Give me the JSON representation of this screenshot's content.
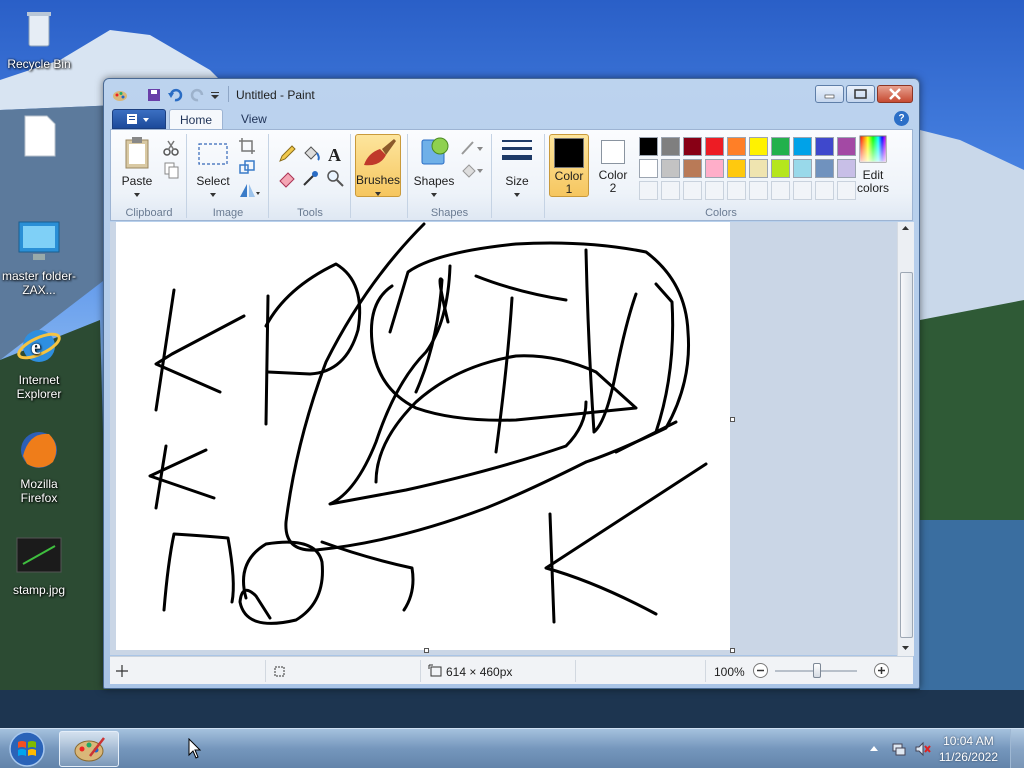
{
  "desktop": {
    "icons": [
      {
        "label": "Recycle Bin",
        "icon": "recycle-bin-icon"
      },
      {
        "label": "",
        "icon": "blank-file-icon"
      },
      {
        "label": "master folder-ZAX...",
        "icon": "network-computer-icon"
      },
      {
        "label": "Internet Explorer",
        "icon": "internet-explorer-icon"
      },
      {
        "label": "Mozilla Firefox",
        "icon": "firefox-icon"
      },
      {
        "label": "stamp.jpg",
        "icon": "image-file-icon"
      }
    ]
  },
  "window": {
    "title": "Untitled - Paint",
    "tabs": [
      "Home",
      "View"
    ],
    "help": "?",
    "groups": {
      "clipboard": {
        "label": "Clipboard",
        "paste": "Paste"
      },
      "image": {
        "label": "Image",
        "select": "Select"
      },
      "tools": {
        "label": "Tools"
      },
      "brushes": {
        "label": "Brushes"
      },
      "shapes": {
        "label": "Shapes",
        "shapes_btn": "Shapes"
      },
      "size": {
        "label": "Size"
      },
      "colors": {
        "label": "Colors",
        "color1": "Color",
        "color1_num": "1",
        "color2": "Color",
        "color2_num": "2",
        "edit_colors_1": "Edit",
        "edit_colors_2": "colors",
        "row1": [
          "#000000",
          "#7f7f7f",
          "#880015",
          "#ed1c24",
          "#ff7f27",
          "#fff200",
          "#22b14c",
          "#00a2e8",
          "#3f48cc",
          "#a349a4"
        ],
        "row2": [
          "#ffffff",
          "#c3c3c3",
          "#b97a57",
          "#ffaec9",
          "#ffc90e",
          "#efe4b0",
          "#b5e61d",
          "#99d9ea",
          "#7092be",
          "#c8bfe7"
        ]
      }
    },
    "status": {
      "dimensions": "614 × 460px",
      "zoom": "100%"
    }
  },
  "taskbar": {
    "time": "10:04 AM",
    "date": "11/26/2022"
  },
  "colors": {
    "accent": "#f6c660",
    "titlebar": "#bcd3ee"
  }
}
